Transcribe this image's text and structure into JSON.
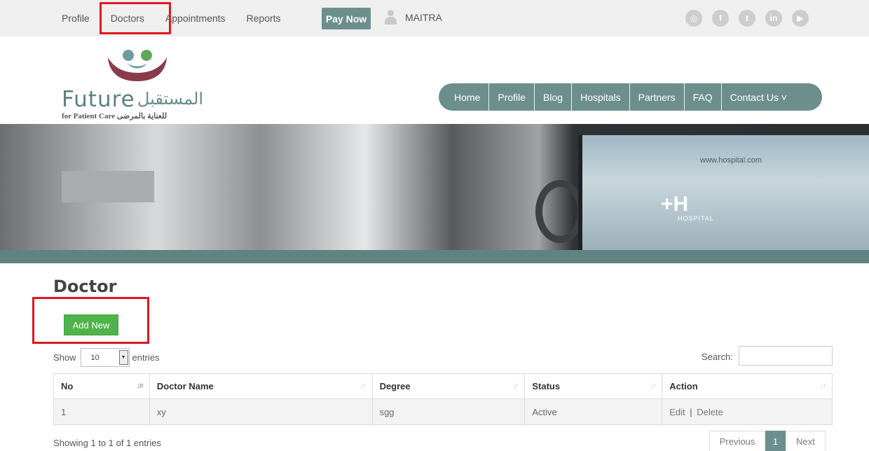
{
  "topbar": {
    "links": [
      "Profile",
      "Doctors",
      "Appointments",
      "Reports"
    ],
    "pay_now": "Pay Now",
    "user_name": "MAITRA",
    "social_icons": [
      "instagram-icon",
      "facebook-icon",
      "twitter-icon",
      "linkedin-icon",
      "youtube-icon"
    ]
  },
  "logo": {
    "english": "Future",
    "arabic": "المستقبل",
    "subtitle": "for Patient Care للعناية بالمرضى"
  },
  "mainnav": [
    "Home",
    "Profile",
    "Blog",
    "Hospitals",
    "Partners",
    "FAQ",
    "Contact Us ˅"
  ],
  "banner": {
    "screen_url": "www.hospital.com",
    "screen_logo": "+H",
    "screen_logo_text": "HOSPITAL"
  },
  "page": {
    "title": "Doctor",
    "add_new": "Add New"
  },
  "table_controls": {
    "show_label": "Show",
    "page_size": "10",
    "entries_label": "entries",
    "search_label": "Search:",
    "search_value": ""
  },
  "table": {
    "headers": [
      "No",
      "Doctor Name",
      "Degree",
      "Status",
      "Action"
    ],
    "rows": [
      {
        "no": "1",
        "doctor_name": "xy",
        "degree": "sgg",
        "status": "Active",
        "edit": "Edit",
        "separator": "|",
        "delete": "Delete"
      }
    ]
  },
  "pagination": {
    "info": "Showing 1 to 1 of 1 entries",
    "previous": "Previous",
    "current": "1",
    "next": "Next"
  },
  "colors": {
    "brand_teal": "#6c8f8e",
    "add_green": "#4fb24a",
    "highlight_red": "#e0191f"
  }
}
